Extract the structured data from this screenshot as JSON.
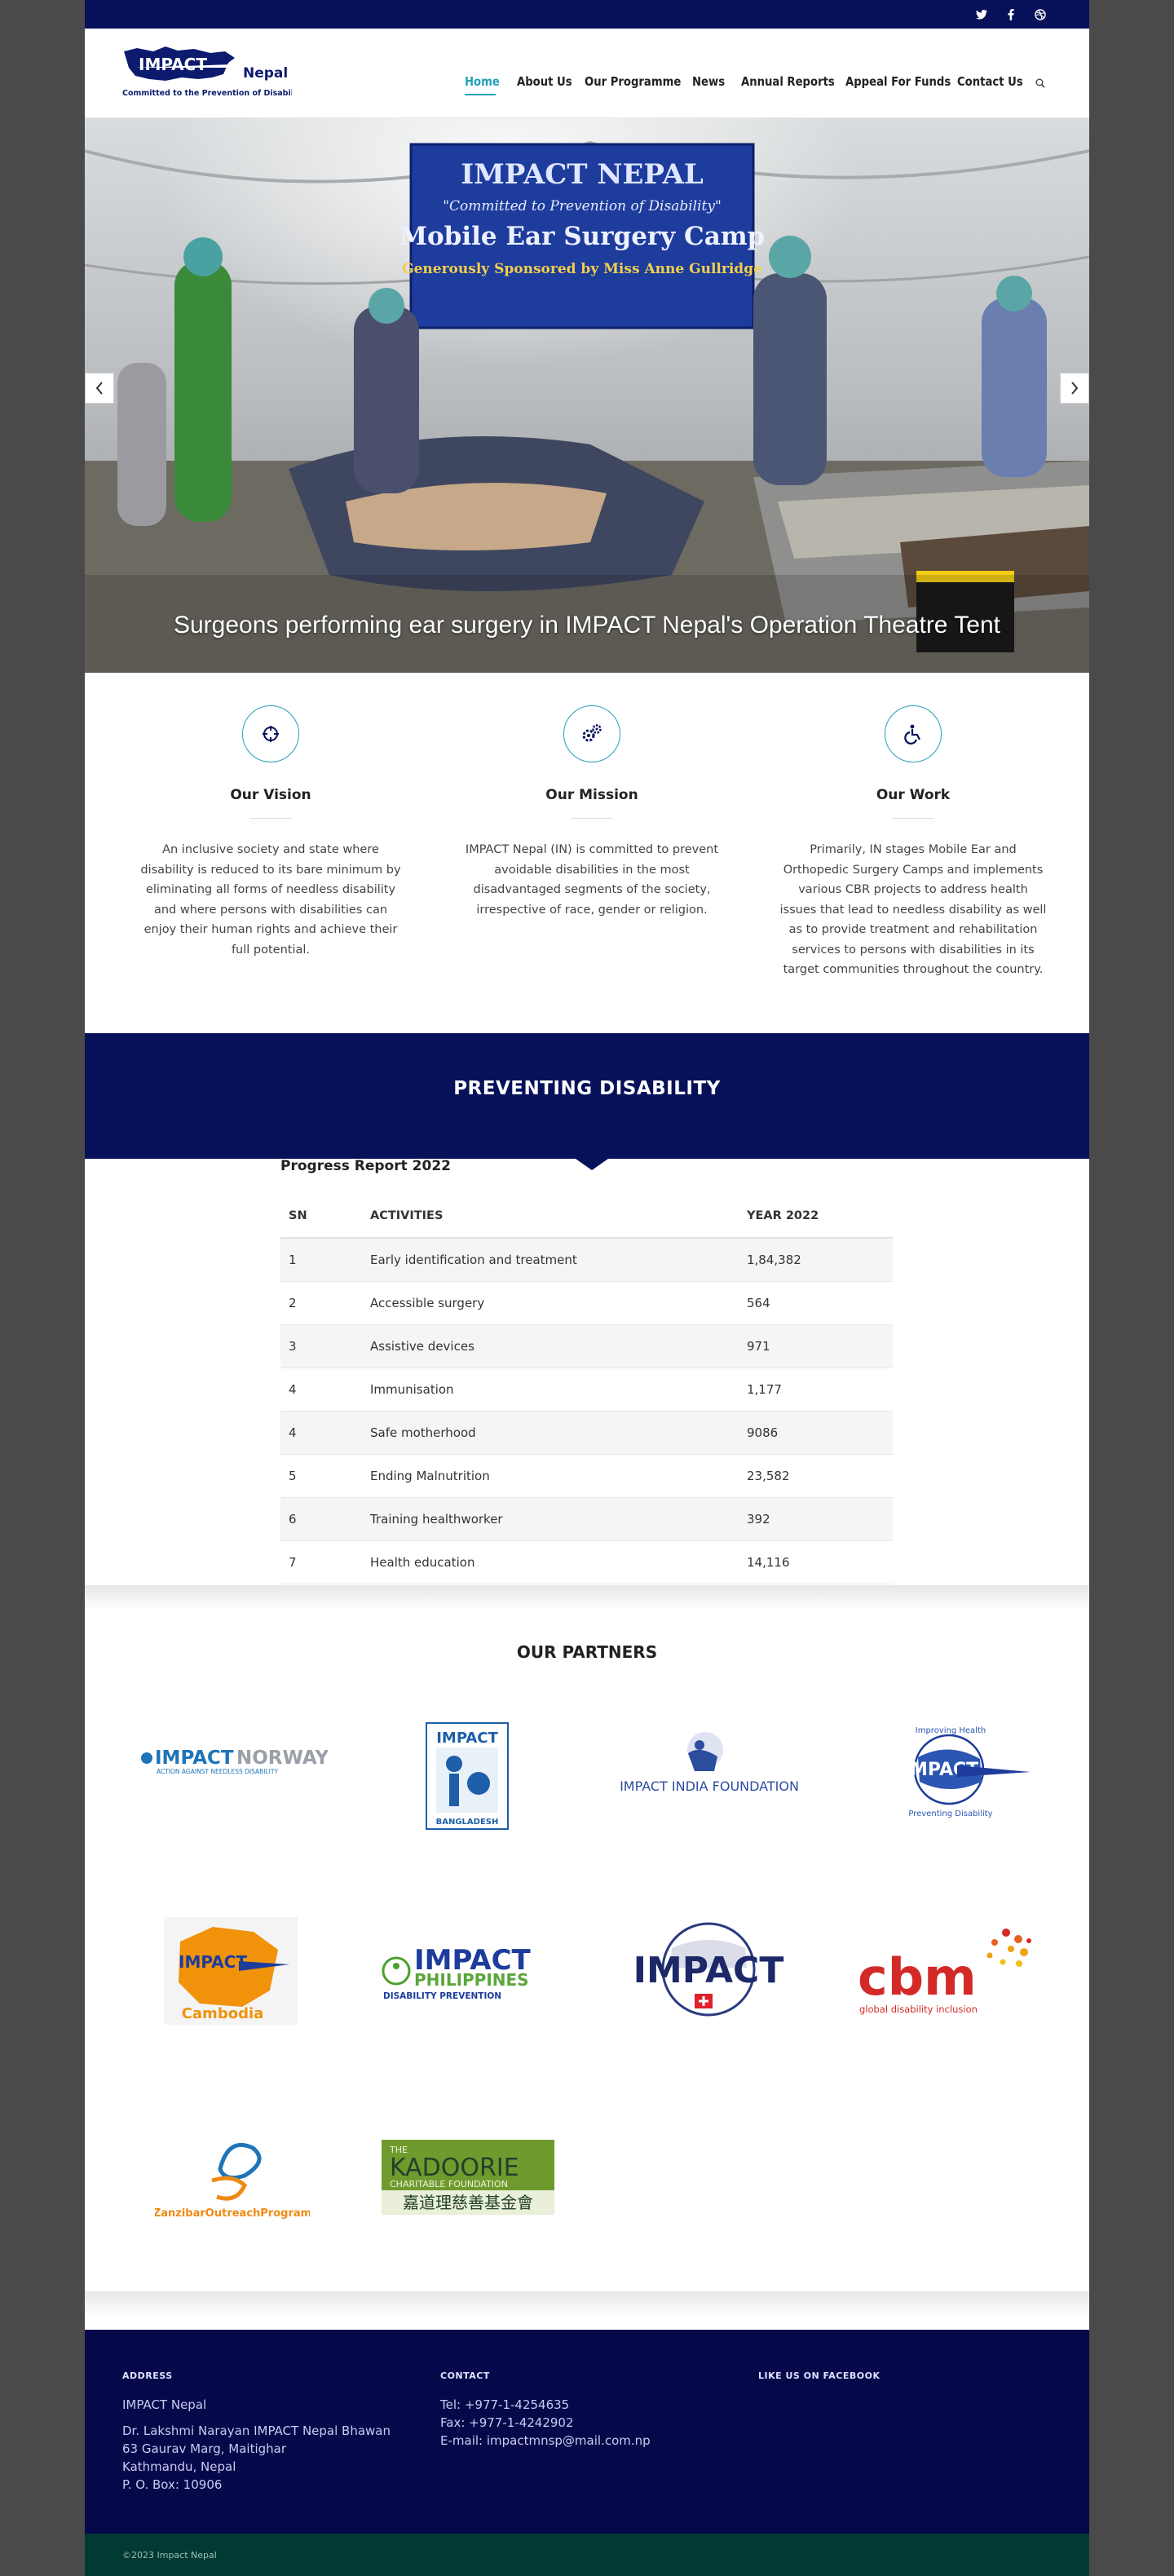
{
  "brand": {
    "name": "IMPACT",
    "suffix": "Nepal",
    "tagline": "Committed to the Prevention of Disability"
  },
  "social": [
    "twitter-icon",
    "facebook-icon",
    "dribbble-icon"
  ],
  "nav": [
    {
      "label": "Home",
      "active": true
    },
    {
      "label": "About Us"
    },
    {
      "label": "Our Programme"
    },
    {
      "label": "News"
    },
    {
      "label": "Annual Reports"
    },
    {
      "label": "Appeal For Funds"
    },
    {
      "label": "Contact Us"
    }
  ],
  "hero": {
    "banner_line1": "IMPACT NEPAL",
    "banner_line2": "\"Committed to Prevention of Disability\"",
    "banner_line3": "Mobile Ear Surgery Camp",
    "banner_line4": "Generously Sponsored by Miss Anne Gullridge",
    "caption": "Surgeons performing ear surgery in IMPACT Nepal's Operation Theatre Tent"
  },
  "pillars": [
    {
      "title": "Our Vision",
      "icon": "crosshair-icon",
      "text": "An inclusive society and state where disability is reduced to its bare minimum by eliminating all forms of needless disability and where persons with disabilities can enjoy their human rights and achieve their full potential."
    },
    {
      "title": "Our Mission",
      "icon": "gears-icon",
      "text": "IMPACT Nepal (IN) is committed to prevent avoidable disabilities in the most disadvantaged segments of the society, irrespective of race, gender or religion."
    },
    {
      "title": "Our Work",
      "icon": "wheelchair-icon",
      "text": "Primarily, IN stages Mobile Ear and Orthopedic Surgery Camps and implements various CBR projects to address health issues that lead to needless disability as well as to provide treatment and rehabilitation services to persons with disabilities in its target communities throughout the country."
    }
  ],
  "band_title": "PREVENTING DISABILITY",
  "progress": {
    "title": "Progress Report 2022",
    "headers": [
      "SN",
      "ACTIVITIES",
      "YEAR 2022"
    ],
    "rows": [
      [
        "1",
        "Early identification and treatment",
        "1,84,382"
      ],
      [
        "2",
        "Accessible surgery",
        "564"
      ],
      [
        "3",
        "Assistive devices",
        "971"
      ],
      [
        "4",
        "Immunisation",
        "1,177"
      ],
      [
        "4",
        "Safe motherhood",
        "9086"
      ],
      [
        "5",
        "Ending Malnutrition",
        "23,582"
      ],
      [
        "6",
        "Training healthworker",
        "392"
      ],
      [
        "7",
        "Health education",
        "14,116"
      ]
    ]
  },
  "partners": {
    "title": "OUR PARTNERS",
    "logos": {
      "norway_a": "IMPACT",
      "norway_b": "NORWAY",
      "norway_c": "ACTION AGAINST NEEDLESS DISABILITY",
      "bangladesh_a": "IMPACT",
      "bangladesh_b": "BANGLADESH",
      "india": "IMPACT INDIA FOUNDATION",
      "intl_a": "IMPACT",
      "intl_b": "Improving Health",
      "intl_c": "Preventing Disability",
      "cambodia_a": "IMPACT",
      "cambodia_b": "Cambodia",
      "philippines_a": "IMPACT",
      "philippines_b": "PHILIPPINES",
      "philippines_c": "DISABILITY PREVENTION",
      "swiss": "IMPACT",
      "cbm_a": "cbm",
      "cbm_b": "global disability inclusion",
      "zanzibar": "ZanzibarOutreachProgram",
      "kadoorie_a": "THE",
      "kadoorie_b": "KADOORIE",
      "kadoorie_c": "CHARITABLE FOUNDATION",
      "kadoorie_d": "嘉道理慈善基金會"
    }
  },
  "footer": {
    "address_heading": "ADDRESS",
    "address_name": "IMPACT Nepal",
    "address_lines": [
      "Dr. Lakshmi Narayan IMPACT Nepal Bhawan",
      "63 Gaurav Marg, Maitighar",
      "Kathmandu, Nepal",
      "P. O. Box: 10906"
    ],
    "contact_heading": "CONTACT",
    "contact_lines": [
      "Tel: +977-1-4254635",
      "Fax: +977-1-4242902",
      "E-mail: impactmnsp@mail.com.np"
    ],
    "facebook_heading": "LIKE US ON FACEBOOK",
    "copyright": "©2023 Impact Nepal"
  },
  "colors": {
    "navy": "#06115a",
    "accent": "#22a0b8",
    "footer": "#06084a",
    "subfooter": "#003a32"
  }
}
